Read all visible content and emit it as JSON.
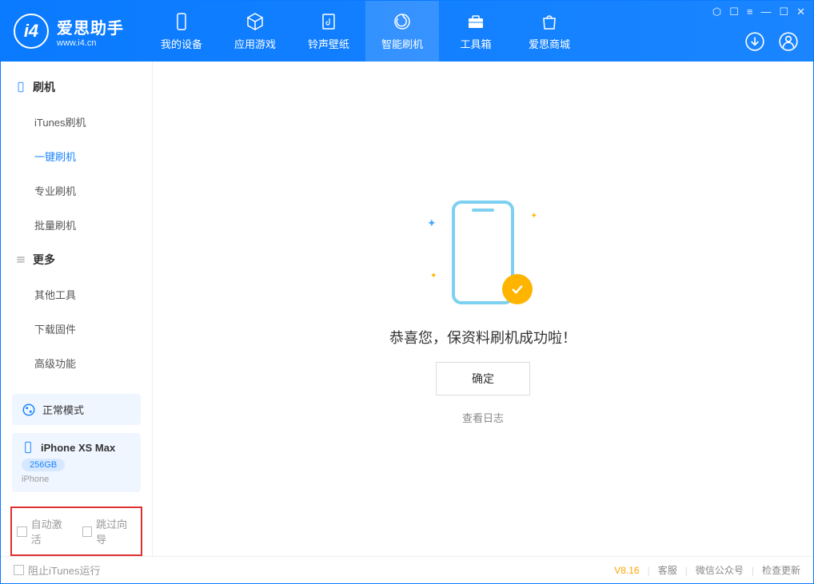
{
  "app": {
    "title": "爱思助手",
    "subtitle": "www.i4.cn"
  },
  "nav": {
    "tabs": [
      {
        "label": "我的设备",
        "icon": "device"
      },
      {
        "label": "应用游戏",
        "icon": "cube"
      },
      {
        "label": "铃声壁纸",
        "icon": "music"
      },
      {
        "label": "智能刷机",
        "icon": "refresh",
        "active": true
      },
      {
        "label": "工具箱",
        "icon": "toolbox"
      },
      {
        "label": "爱思商城",
        "icon": "bag"
      }
    ]
  },
  "sidebar": {
    "groups": [
      {
        "title": "刷机",
        "icon": "phone",
        "items": [
          {
            "label": "iTunes刷机"
          },
          {
            "label": "一键刷机",
            "active": true
          },
          {
            "label": "专业刷机"
          },
          {
            "label": "批量刷机"
          }
        ]
      },
      {
        "title": "更多",
        "icon": "menu",
        "items": [
          {
            "label": "其他工具"
          },
          {
            "label": "下载固件"
          },
          {
            "label": "高级功能"
          }
        ]
      }
    ],
    "mode": {
      "label": "正常模式"
    },
    "device": {
      "name": "iPhone XS Max",
      "storage": "256GB",
      "type": "iPhone"
    },
    "options": {
      "auto_activate": "自动激活",
      "skip_guide": "跳过向导"
    }
  },
  "main": {
    "success_message": "恭喜您，保资料刷机成功啦！",
    "confirm_label": "确定",
    "view_log_label": "查看日志"
  },
  "footer": {
    "block_itunes": "阻止iTunes运行",
    "version": "V8.16",
    "links": [
      "客服",
      "微信公众号",
      "检查更新"
    ]
  }
}
